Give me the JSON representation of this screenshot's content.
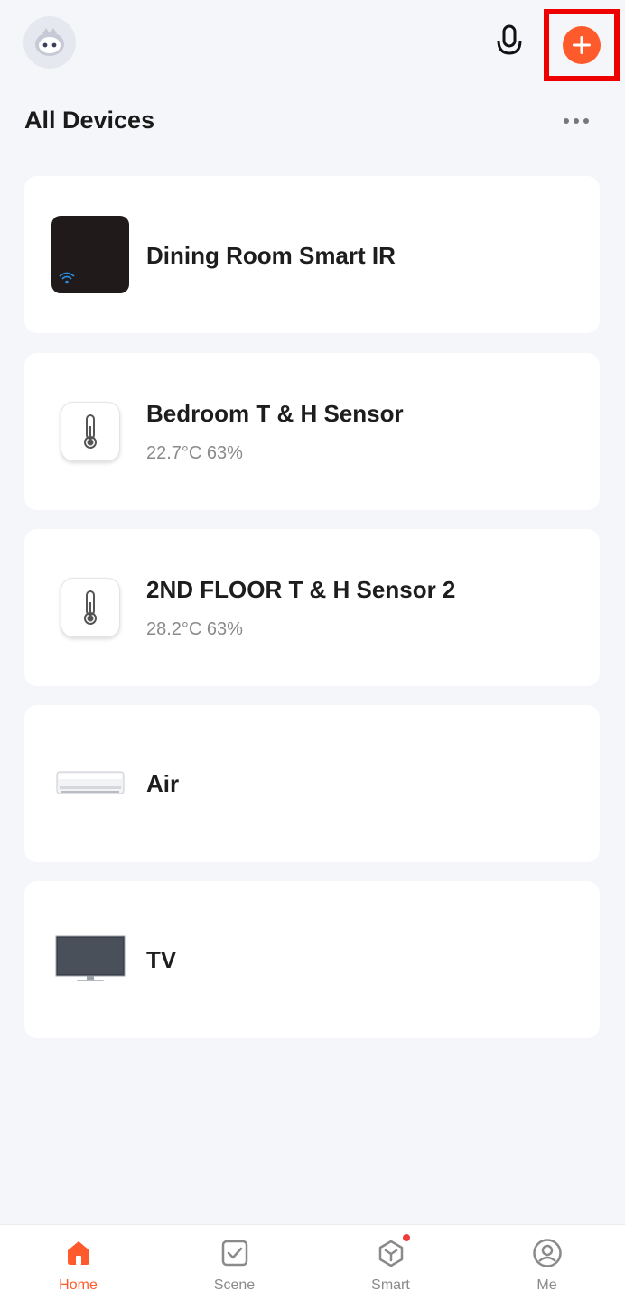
{
  "header": {
    "title": "All Devices"
  },
  "devices": [
    {
      "name": "Dining Room Smart IR",
      "status": "",
      "icon": "smart-ir-hub-icon"
    },
    {
      "name": "Bedroom T & H Sensor",
      "status": "22.7°C  63%",
      "icon": "thermometer-sensor-icon"
    },
    {
      "name": "2ND FLOOR T & H Sensor 2",
      "status": "28.2°C  63%",
      "icon": "thermometer-sensor-icon"
    },
    {
      "name": "Air",
      "status": "",
      "icon": "air-conditioner-icon"
    },
    {
      "name": "TV",
      "status": "",
      "icon": "tv-icon"
    }
  ],
  "tabs": [
    {
      "label": "Home",
      "icon": "home-icon",
      "active": true
    },
    {
      "label": "Scene",
      "icon": "scene-check-icon",
      "active": false
    },
    {
      "label": "Smart",
      "icon": "smart-cube-icon",
      "active": false,
      "badge": true
    },
    {
      "label": "Me",
      "icon": "profile-icon",
      "active": false
    }
  ],
  "colors": {
    "accent": "#ff5a2c",
    "background": "#f5f6fa",
    "highlight_box": "#ee0000"
  }
}
